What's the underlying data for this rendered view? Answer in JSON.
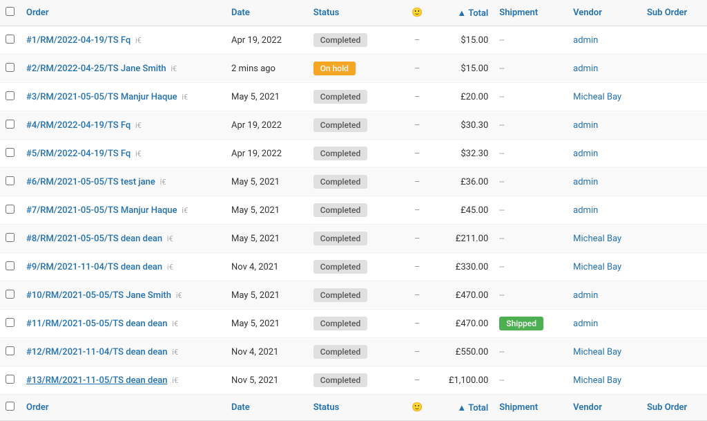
{
  "columns": {
    "order": "Order",
    "date": "Date",
    "status": "Status",
    "total": "Total",
    "shipment": "Shipment",
    "vendor": "Vendor",
    "suborder": "Sub Order"
  },
  "rows": [
    {
      "id": 1,
      "order": "#1/RM/2022-04-19/TS Fq",
      "order_underline": false,
      "date": "Apr 19, 2022",
      "status": "Completed",
      "status_type": "completed",
      "total": "$15.00",
      "shipment": "--",
      "vendor": "admin",
      "suborder": ""
    },
    {
      "id": 2,
      "order": "#2/RM/2022-04-25/TS Jane Smith",
      "order_underline": false,
      "date": "2 mins ago",
      "status": "On hold",
      "status_type": "onhold",
      "total": "$15.00",
      "shipment": "--",
      "vendor": "admin",
      "suborder": ""
    },
    {
      "id": 3,
      "order": "#3/RM/2021-05-05/TS Manjur Haque",
      "order_underline": false,
      "date": "May 5, 2021",
      "status": "Completed",
      "status_type": "completed",
      "total": "£20.00",
      "shipment": "--",
      "vendor": "Micheal Bay",
      "suborder": ""
    },
    {
      "id": 4,
      "order": "#4/RM/2022-04-19/TS Fq",
      "order_underline": false,
      "date": "Apr 19, 2022",
      "status": "Completed",
      "status_type": "completed",
      "total": "$30.30",
      "shipment": "--",
      "vendor": "admin",
      "suborder": ""
    },
    {
      "id": 5,
      "order": "#5/RM/2022-04-19/TS Fq",
      "order_underline": false,
      "date": "Apr 19, 2022",
      "status": "Completed",
      "status_type": "completed",
      "total": "$32.30",
      "shipment": "--",
      "vendor": "admin",
      "suborder": ""
    },
    {
      "id": 6,
      "order": "#6/RM/2021-05-05/TS test jane",
      "order_underline": false,
      "date": "May 5, 2021",
      "status": "Completed",
      "status_type": "completed",
      "total": "£36.00",
      "shipment": "--",
      "vendor": "admin",
      "suborder": ""
    },
    {
      "id": 7,
      "order": "#7/RM/2021-05-05/TS Manjur Haque",
      "order_underline": false,
      "date": "May 5, 2021",
      "status": "Completed",
      "status_type": "completed",
      "total": "£45.00",
      "shipment": "--",
      "vendor": "admin",
      "suborder": ""
    },
    {
      "id": 8,
      "order": "#8/RM/2021-05-05/TS dean dean",
      "order_underline": false,
      "date": "May 5, 2021",
      "status": "Completed",
      "status_type": "completed",
      "total": "£211.00",
      "shipment": "--",
      "vendor": "Micheal Bay",
      "suborder": ""
    },
    {
      "id": 9,
      "order": "#9/RM/2021-11-04/TS dean dean",
      "order_underline": false,
      "date": "Nov 4, 2021",
      "status": "Completed",
      "status_type": "completed",
      "total": "£330.00",
      "shipment": "--",
      "vendor": "Micheal Bay",
      "suborder": ""
    },
    {
      "id": 10,
      "order": "#10/RM/2021-05-05/TS Jane Smith",
      "order_underline": false,
      "date": "May 5, 2021",
      "status": "Completed",
      "status_type": "completed",
      "total": "£470.00",
      "shipment": "--",
      "vendor": "admin",
      "suborder": ""
    },
    {
      "id": 11,
      "order": "#11/RM/2021-05-05/TS dean dean",
      "order_underline": false,
      "date": "May 5, 2021",
      "status": "Completed",
      "status_type": "completed",
      "total": "£470.00",
      "shipment": "Shipped",
      "shipment_type": "shipped",
      "vendor": "admin",
      "suborder": ""
    },
    {
      "id": 12,
      "order": "#12/RM/2021-11-04/TS dean dean",
      "order_underline": false,
      "date": "Nov 4, 2021",
      "status": "Completed",
      "status_type": "completed",
      "total": "£550.00",
      "shipment": "--",
      "vendor": "Micheal Bay",
      "suborder": ""
    },
    {
      "id": 13,
      "order": "#13/RM/2021-11-05/TS dean dean",
      "order_underline": true,
      "date": "Nov 5, 2021",
      "status": "Completed",
      "status_type": "completed",
      "total": "£1,100.00",
      "shipment": "--",
      "vendor": "Micheal Bay",
      "suborder": ""
    }
  ]
}
